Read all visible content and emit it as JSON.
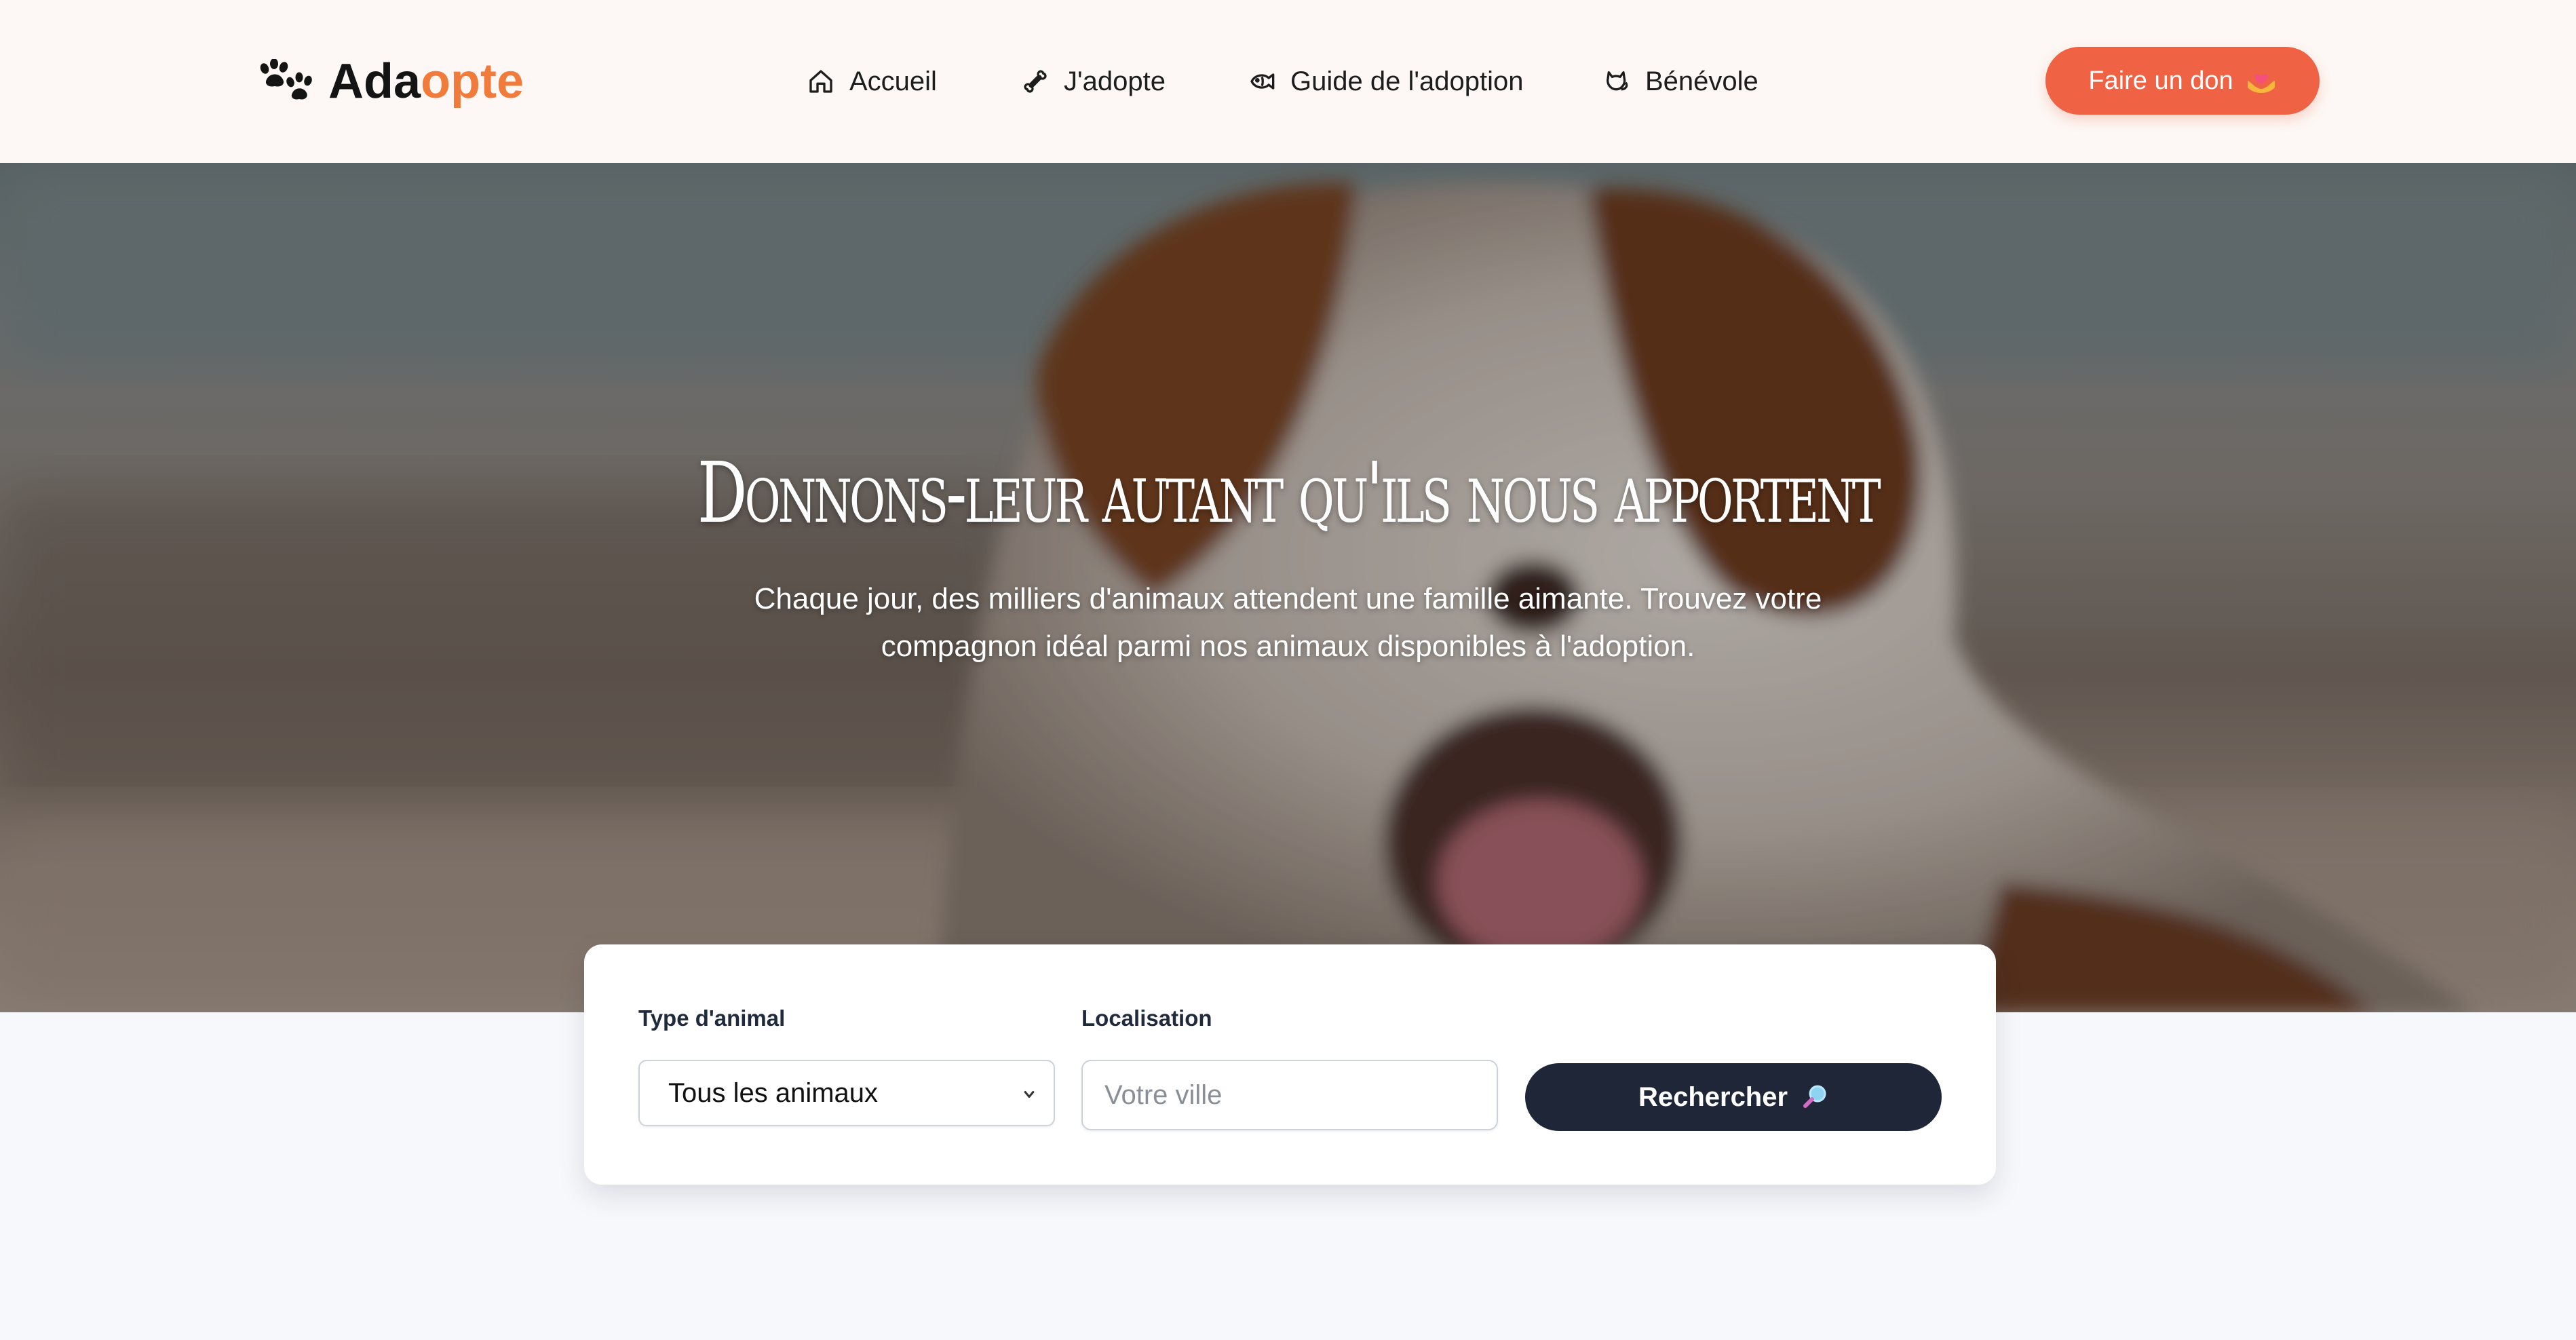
{
  "brand": {
    "name_part1": "Ada",
    "name_part2": "opte",
    "accent": "#f07b3a"
  },
  "nav": {
    "items": [
      {
        "label": "Accueil",
        "icon": "home-icon"
      },
      {
        "label": "J'adopte",
        "icon": "bone-icon"
      },
      {
        "label": "Guide de l'adoption",
        "icon": "fish-icon"
      },
      {
        "label": "Bénévole",
        "icon": "cat-icon"
      }
    ]
  },
  "donate": {
    "label": "Faire un don",
    "icon": "heart-hands-icon",
    "color": "#ef6244"
  },
  "hero": {
    "title": "Donnons-leur autant qu'ils nous apportent",
    "subtitle": "Chaque jour, des milliers d'animaux attendent une famille aimante. Trouvez votre compagnon idéal parmi nos animaux disponibles à l'adoption."
  },
  "search": {
    "type_label": "Type d'animal",
    "type_selected": "Tous les animaux",
    "location_label": "Localisation",
    "location_placeholder": "Votre ville",
    "button_label": "Rechercher",
    "button_icon": "magnifier-icon",
    "button_color": "#1e2637"
  }
}
